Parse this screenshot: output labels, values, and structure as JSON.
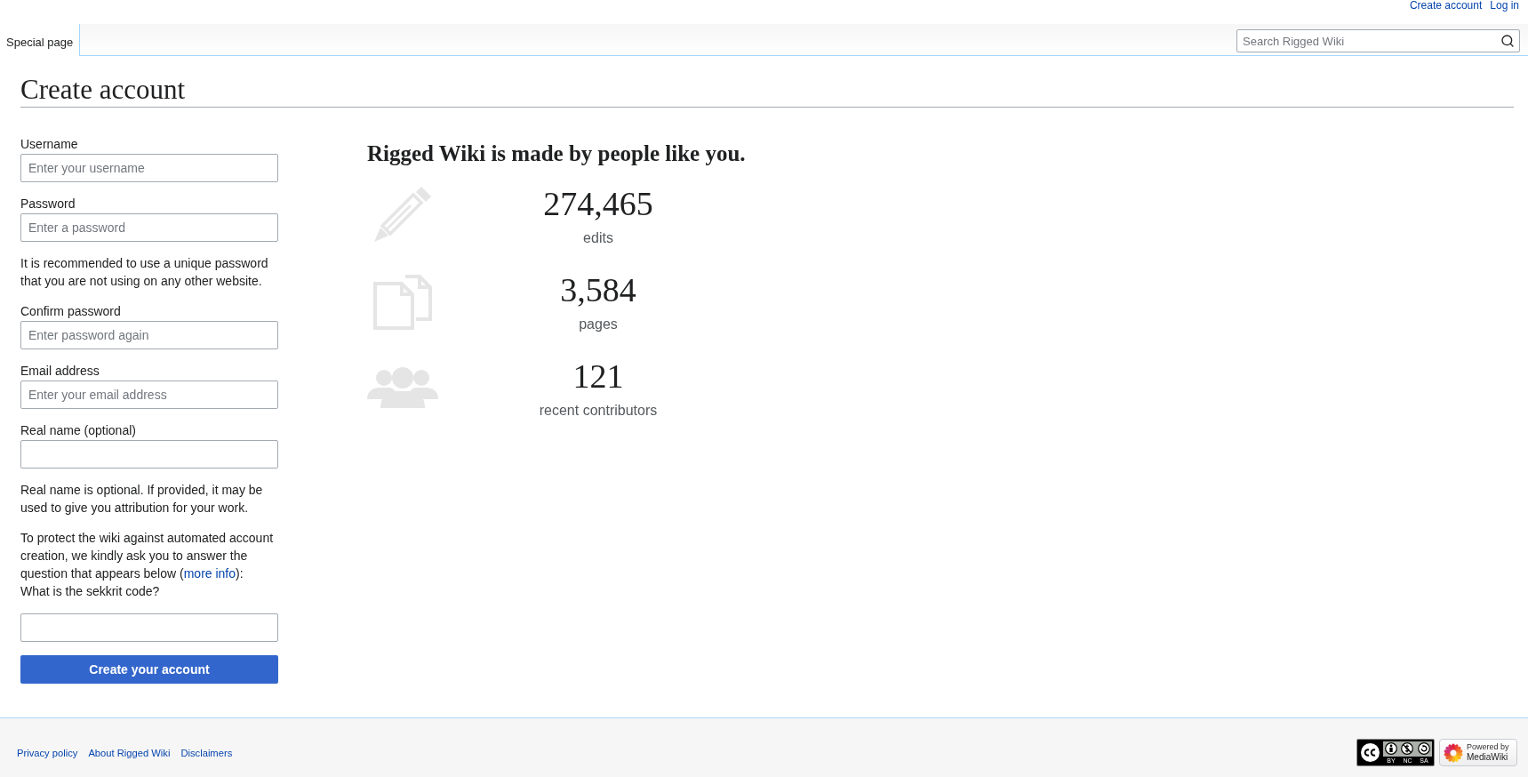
{
  "top_links": [
    {
      "label": "Create account"
    },
    {
      "label": "Log in"
    }
  ],
  "tabs": [
    {
      "label": "Special page",
      "selected": true
    }
  ],
  "search": {
    "placeholder": "Search Rigged Wiki"
  },
  "page": {
    "title": "Create account"
  },
  "form": {
    "items": [
      {
        "kind": "field",
        "label": "Username",
        "placeholder": "Enter your username"
      },
      {
        "kind": "field",
        "label": "Password",
        "placeholder": "Enter a password"
      },
      {
        "kind": "help",
        "text": "It is recommended to use a unique password that you are not using on any other website."
      },
      {
        "kind": "field",
        "label": "Confirm password",
        "placeholder": "Enter password again"
      },
      {
        "kind": "field",
        "label": "Email address",
        "placeholder": "Enter your email address"
      },
      {
        "kind": "field",
        "label": "Real name (optional)"
      },
      {
        "kind": "help",
        "text": "Real name is optional. If provided, it may be used to give you attribution for your work."
      },
      {
        "kind": "captcha",
        "text_before": "To protect the wiki against automated account creation, we kindly ask you to answer the question that appears below (",
        "link": "more info",
        "text_after": "):",
        "question": "What is the sekkrit code?"
      }
    ],
    "submit": "Create your account"
  },
  "benefits": {
    "heading": "Rigged Wiki is made by people like you.",
    "items": [
      {
        "kind": "edits",
        "count": "274,465",
        "label": "edits"
      },
      {
        "kind": "pages",
        "count": "3,584",
        "label": "pages"
      },
      {
        "kind": "contributors",
        "count": "121",
        "label": "recent contributors"
      }
    ]
  },
  "footer": {
    "links": [
      "Privacy policy",
      "About Rigged Wiki",
      "Disclaimers"
    ],
    "badges": [
      {
        "kind": "license",
        "terms": [
          "BY",
          "NC",
          "SA"
        ]
      },
      {
        "kind": "powered",
        "lines": [
          "Powered by",
          "MediaWiki"
        ]
      }
    ]
  }
}
